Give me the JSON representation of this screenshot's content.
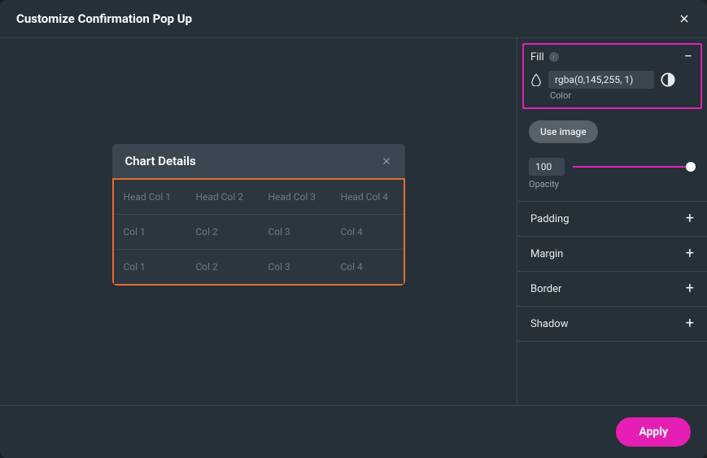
{
  "header": {
    "title": "Customize Confirmation Pop Up"
  },
  "widget": {
    "title": "Chart Details",
    "headers": [
      "Head Col 1",
      "Head Col 2",
      "Head Col 3",
      "Head Col 4"
    ],
    "rows": [
      [
        "Col 1",
        "Col 2",
        "Col 3",
        "Col 4"
      ],
      [
        "Col 1",
        "Col 2",
        "Col 3",
        "Col 4"
      ]
    ]
  },
  "panel": {
    "fill": {
      "label": "Fill",
      "color_value": "rgba(0,145,255, 1)",
      "color_label": "Color"
    },
    "use_image": "Use image",
    "opacity": {
      "value": "100",
      "label": "Opacity"
    },
    "sections": [
      {
        "label": "Padding"
      },
      {
        "label": "Margin"
      },
      {
        "label": "Border"
      },
      {
        "label": "Shadow"
      }
    ]
  },
  "footer": {
    "apply": "Apply"
  }
}
